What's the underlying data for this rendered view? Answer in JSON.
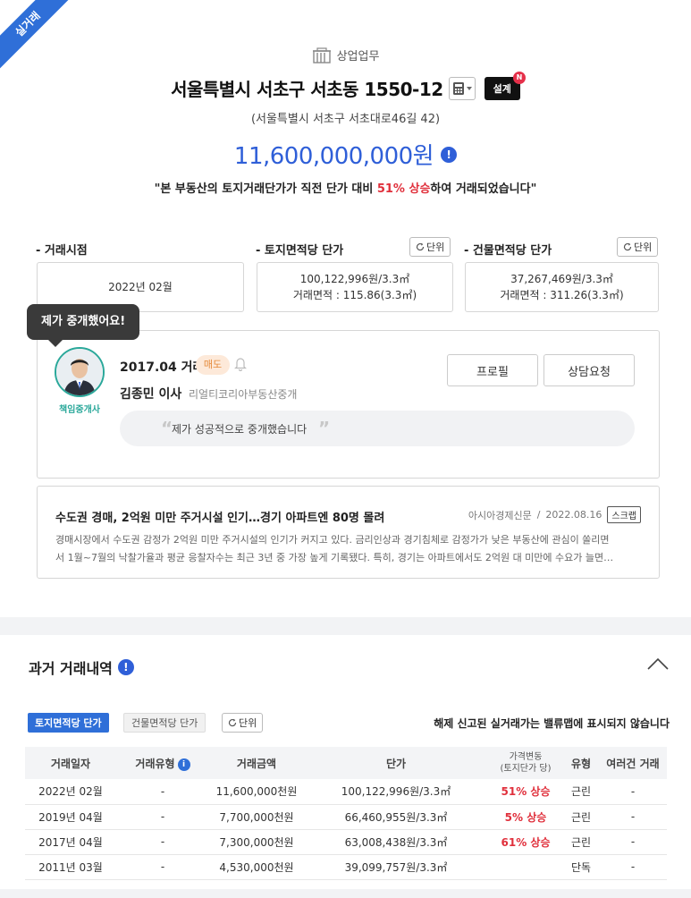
{
  "ribbon": "실거래",
  "header": {
    "category": "상업업무",
    "address": "서울특별시 서초구 서초동 1550-12",
    "design_label": "설계",
    "design_badge": "N",
    "road_address": "(서울특별시 서초구 서초대로46길 42)",
    "price": "11,600,000,000원",
    "trend_prefix": "\"본 부동산의 토지거래단가가 직전 단가 대비 ",
    "trend_highlight": "51% 상승",
    "trend_suffix": "하여 거래되었습니다\""
  },
  "stats": {
    "deal_time": {
      "label": "- 거래시점",
      "value": "2022년 02월"
    },
    "land_unit": {
      "label": "- 토지면적당 단가",
      "unit_btn": "단위",
      "line1": "100,122,996원/3.3㎡",
      "line2": "거래면적 : 115.86(3.3㎡)"
    },
    "building_unit": {
      "label": "- 건물면적당 단가",
      "unit_btn": "단위",
      "line1": "37,267,469원/3.3㎡",
      "line2": "거래면적 : 311.26(3.3㎡)"
    }
  },
  "broker": {
    "bubble": "제가 중개했어요!",
    "caption": "책임중개사",
    "deal_date": "2017.04 거래",
    "deal_type": "매도",
    "name": "김종민 이사",
    "office": "리얼티코리아부동산중개",
    "profile_btn": "프로필",
    "consult_btn": "상담요청",
    "comment": "제가 성공적으로 중개했습니다"
  },
  "news": {
    "title": "수도권 경매, 2억원 미만 주거시설 인기…경기 아파트엔 80명 몰려",
    "source": "아시아경제신문",
    "date": "2022.08.16",
    "scrap": "스크랩",
    "line1": "경매시장에서 수도권 감정가 2억원 미만 주거시설의 인기가 커지고 있다. 금리인상과 경기침체로 감정가가 낮은 부동산에 관심이 쏠리면",
    "line2": "서 1월~7월의 낙찰가율과 평균 응찰자수는 최근 3년 중 가장 높게 기록됐다. 특히, 경기는 아파트에서도 2억원 대 미만에 수요가 늘면…"
  },
  "history": {
    "title": "과거 거래내역",
    "tab_land": "토지면적당 단가",
    "tab_building": "건물면적당 단가",
    "unit_btn": "단위",
    "notice": "해제 신고된 실거래가는 밸류맵에 표시되지 않습니다",
    "columns": {
      "date": "거래일자",
      "type": "거래유형",
      "amount": "거래금액",
      "unit_price": "단가",
      "change": "가격변동",
      "change_sub": "(토지단가 당)",
      "kind": "유형",
      "multi": "여러건 거래"
    },
    "rows": [
      {
        "date": "2022년 02월",
        "type": "-",
        "amount": "11,600,000천원",
        "unit_price": "100,122,996원/3.3㎡",
        "change": "51% 상승",
        "kind": "근린",
        "multi": "-"
      },
      {
        "date": "2019년 04월",
        "type": "-",
        "amount": "7,700,000천원",
        "unit_price": "66,460,955원/3.3㎡",
        "change": "5% 상승",
        "kind": "근린",
        "multi": "-"
      },
      {
        "date": "2017년 04월",
        "type": "-",
        "amount": "7,300,000천원",
        "unit_price": "63,008,438원/3.3㎡",
        "change": "61% 상승",
        "kind": "근린",
        "multi": "-"
      },
      {
        "date": "2011년 03월",
        "type": "-",
        "amount": "4,530,000천원",
        "unit_price": "39,099,757원/3.3㎡",
        "change": "",
        "kind": "단독",
        "multi": "-"
      }
    ]
  }
}
